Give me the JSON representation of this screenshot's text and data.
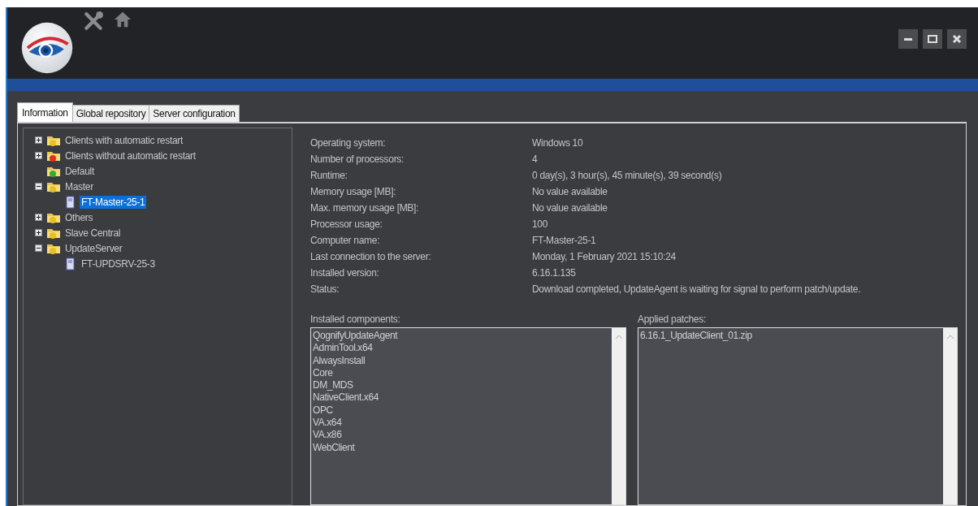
{
  "tabs": [
    {
      "label": "Information",
      "selected": true
    },
    {
      "label": "Global repository",
      "selected": false
    },
    {
      "label": "Server configuration",
      "selected": false
    }
  ],
  "tree": [
    {
      "label": "Clients with automatic restart",
      "kind": "folder",
      "color": "#e8c020",
      "expanded": false,
      "selected": false
    },
    {
      "label": "Clients without automatic restart",
      "kind": "folder",
      "color": "#e03020",
      "expanded": false,
      "selected": false
    },
    {
      "label": "Default",
      "kind": "folder",
      "color": "#30b030",
      "selected": false
    },
    {
      "label": "Master",
      "kind": "folder",
      "color": "#e8c020",
      "expanded": true,
      "selected": false,
      "children": [
        {
          "label": "FT-Master-25-1",
          "kind": "server",
          "selected": true
        }
      ]
    },
    {
      "label": "Others",
      "kind": "folder",
      "color": "#e8c020",
      "expanded": false,
      "selected": false
    },
    {
      "label": "Slave Central",
      "kind": "folder",
      "color": "#e8c020",
      "expanded": false,
      "selected": false
    },
    {
      "label": "UpdateServer",
      "kind": "folder",
      "color": "#e8c020",
      "expanded": true,
      "selected": false,
      "children": [
        {
          "label": "FT-UPDSRV-25-3",
          "kind": "server",
          "selected": false
        }
      ]
    }
  ],
  "details": [
    {
      "label": "Operating system:",
      "value": "Windows 10"
    },
    {
      "label": "Number of processors:",
      "value": "4"
    },
    {
      "label": "Runtime:",
      "value": "0 day(s), 3 hour(s), 45 minute(s), 39 second(s)"
    },
    {
      "label": "Memory usage [MB]:",
      "value": "No value available"
    },
    {
      "label": "Max. memory usage [MB]:",
      "value": "No value available"
    },
    {
      "label": "Processor usage:",
      "value": "100"
    },
    {
      "label": "Computer name:",
      "value": "FT-Master-25-1"
    },
    {
      "label": "Last connection to the server:",
      "value": "Monday, 1 February 2021 15:10:24"
    },
    {
      "label": "Installed version:",
      "value": "6.16.1.135"
    },
    {
      "label": "Status:",
      "value": "Download completed, UpdateAgent is waiting for signal to perform patch/update."
    }
  ],
  "installed_components": {
    "label": "Installed components:",
    "items": [
      "QognifyUpdateAgent",
      "AdminTool.x64",
      "AlwaysInstall",
      "Core",
      "DM_MDS",
      "NativeClient.x64",
      "OPC",
      "VA.x64",
      "VA.x86",
      "WebClient"
    ]
  },
  "applied_patches": {
    "label": "Applied patches:",
    "items": [
      "6.16.1_UpdateClient_01.zip"
    ]
  }
}
